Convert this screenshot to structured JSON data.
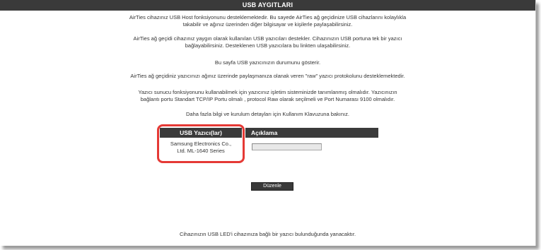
{
  "header": {
    "title": "USB AYGITLARI"
  },
  "intro": {
    "p1_line1": "AirTies cihazınız USB Host fonksiyonunu desteklemektedir. Bu sayede AirTies ağ geçidinize USB cihazlarını kolaylıkla",
    "p1_line2": "takabilir ve ağınız üzerinden diğer bilgisayar ve kişilerle paylaşabilirsiniz.",
    "p2_line1": "AirTies ağ geçidi cihazınız yaygın olarak kullanılan USB yazıcıları destekler. Cihazınızın USB portuna tek bir yazıcı",
    "p2_line2": "bağlayabilirsiniz. Desteklenen USB yazıcılara bu linkten ulaşabilirsiniz.",
    "p3": "Bu sayfa USB yazıcınızın durumunu gösterir.",
    "p4": "AirTies ağ geçidiniz yazıcınızı ağınız üzerinde paylaşmanıza olanak veren \"raw\" yazıcı protokolunu desteklemektedir.",
    "p5_line1": "Yazıcı sunucu fonksiyonunu kullanabilmek için yazıcınız işletim sisteminizde tanımlanmış olmalıdır. Yazıcınızın",
    "p5_line2": "bağlantı portu Standart TCP/IP Portu olmalı , protocol Raw olarak seçilmeli ve Port Numarası 9100 olmalıdır.",
    "p6": "Daha fazla bilgi ve kurulum detayları için Kullanım Klavuzuna bakınız."
  },
  "table": {
    "col_printer": "USB Yazıcı(lar)",
    "col_desc": "Açıklama",
    "printer_line1": "Samsung Electronics Co.,",
    "printer_line2": "Ltd. ML-1640 Series",
    "desc_value": ""
  },
  "actions": {
    "edit_label": "Düzenle"
  },
  "footer": {
    "note": "Cihazınızın USB LED'i cihazınıza bağlı bir yazıcı bulunduğunda yanacaktır."
  },
  "colors": {
    "header_bg": "#3a3a3a",
    "highlight": "#e53935"
  }
}
